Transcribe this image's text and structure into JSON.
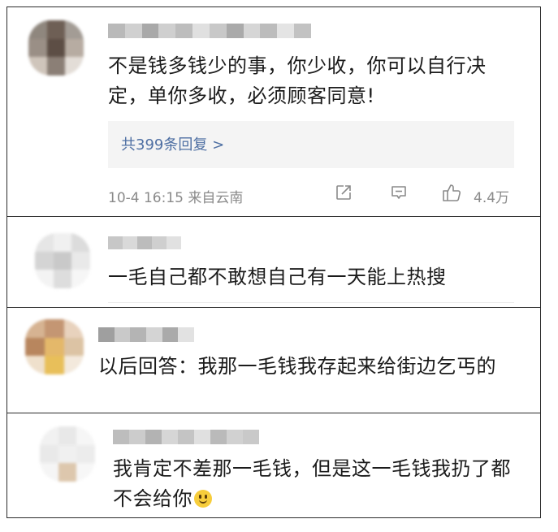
{
  "comments": [
    {
      "text": "不是钱多钱少的事，你少收，你可以自行决定，单你多收，必须顾客同意!",
      "avatar_colors": [
        "#8f877e",
        "#6e5f55",
        "#a39c95",
        "#9a8f86",
        "#5d4e45",
        "#b7aca2",
        "#cfc5bb",
        "#8b7f76",
        "#e3ddd7"
      ],
      "username_colors": [
        "#b9b9b9",
        "#d0d0d0",
        "#a9a9a9",
        "#cfcfcf",
        "#bdbdbd",
        "#e0e0e0",
        "#c8c8c8",
        "#aaaaaa",
        "#d6d6d6",
        "#bcbcbc",
        "#e4e4e4",
        "#c2c2c2"
      ],
      "reply_link": "共399条回复 >",
      "meta": "10-4 16:15 来自云南",
      "likes": "4.4万",
      "icons": [
        "share-icon",
        "comment-icon",
        "like-icon"
      ]
    },
    {
      "text": "一毛自己都不敢想自己有一天能上热搜",
      "avatar_colors": [
        "#e6e6e6",
        "#f0f0f0",
        "#dcdcdc",
        "#d4d4d4",
        "#c9c9c9",
        "#e9e9e9",
        "#f3f3f3",
        "#dddddd",
        "#f6f6f6"
      ],
      "username_colors": [
        "#c7c7c7",
        "#d9d9d9",
        "#bcbcbc",
        "#cfcfcf",
        "#e1e1e1"
      ]
    },
    {
      "text": "以后回答：我那一毛钱我存起来给街边乞丐的",
      "avatar_colors": [
        "#d6b392",
        "#c49673",
        "#e8d2bd",
        "#b8865e",
        "#e4b86a",
        "#dcc3a4",
        "#efe0cc",
        "#e8bf5a",
        "#f3e9dc"
      ],
      "username_colors": [
        "#9f9f9f",
        "#c9c9c9",
        "#b4b4b4",
        "#d4d4d4",
        "#aaaaaa",
        "#e2e2e2"
      ]
    },
    {
      "text": "我肯定不差那一毛钱，但是这一毛钱我扔了都不会给你",
      "emoji": "smile-emoji",
      "avatar_colors": [
        "#f1f1f1",
        "#e8e8e8",
        "#f6f6f6",
        "#e9e9e9",
        "#f0f0f0",
        "#ececec",
        "#f5f5f5",
        "#ddc7ad",
        "#f7f7f7"
      ],
      "username_colors": [
        "#bdbdbd",
        "#cccccc",
        "#b3b3b3",
        "#d6d6d6",
        "#c4c4c4",
        "#e0e0e0",
        "#bababa",
        "#d1d1d1",
        "#c9c9c9"
      ]
    }
  ]
}
